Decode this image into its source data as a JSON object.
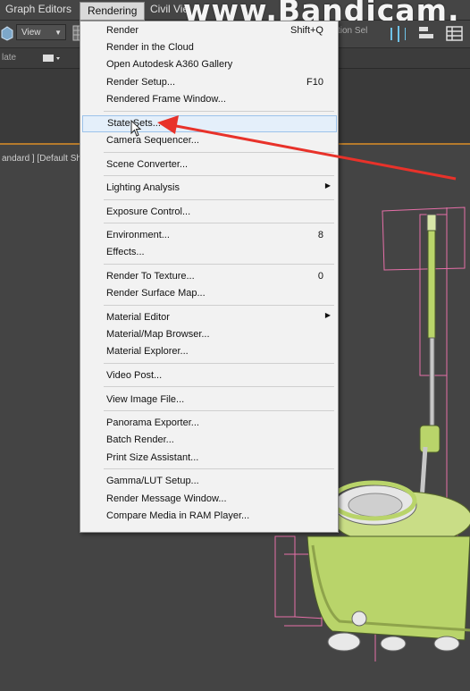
{
  "menubar": {
    "items": [
      {
        "label": "Graph Editors",
        "active": false
      },
      {
        "label": "Rendering",
        "active": true
      },
      {
        "label": "Civil Vie",
        "active": false
      }
    ]
  },
  "watermark": "www.Bandicam.",
  "toolbar": {
    "view_dropdown": "View",
    "selection_set": "tion Sel"
  },
  "row2": {
    "label": "late"
  },
  "viewport": {
    "label": "andard ] [Default Sha"
  },
  "menu": {
    "items": [
      {
        "label": "Render",
        "shortcut": "Shift+Q"
      },
      {
        "label": "Render in the Cloud",
        "shortcut": ""
      },
      {
        "label": "Open Autodesk A360 Gallery",
        "shortcut": ""
      },
      {
        "label": "Render Setup...",
        "shortcut": "F10"
      },
      {
        "label": "Rendered Frame Window...",
        "shortcut": ""
      },
      {
        "label": "State Sets...",
        "shortcut": "",
        "highlighted": true
      },
      {
        "label": "Camera Sequencer...",
        "shortcut": ""
      },
      {
        "label": "Scene Converter...",
        "shortcut": ""
      },
      {
        "label": "Lighting Analysis",
        "shortcut": "",
        "submenu": true
      },
      {
        "label": "Exposure Control...",
        "shortcut": ""
      },
      {
        "label": "Environment...",
        "shortcut": "8"
      },
      {
        "label": "Effects...",
        "shortcut": ""
      },
      {
        "label": "Render To Texture...",
        "shortcut": "0"
      },
      {
        "label": "Render Surface Map...",
        "shortcut": ""
      },
      {
        "label": "Material Editor",
        "shortcut": "",
        "submenu": true
      },
      {
        "label": "Material/Map Browser...",
        "shortcut": ""
      },
      {
        "label": "Material Explorer...",
        "shortcut": ""
      },
      {
        "label": "Video Post...",
        "shortcut": ""
      },
      {
        "label": "View Image File...",
        "shortcut": ""
      },
      {
        "label": "Panorama Exporter...",
        "shortcut": ""
      },
      {
        "label": "Batch Render...",
        "shortcut": ""
      },
      {
        "label": "Print Size Assistant...",
        "shortcut": ""
      },
      {
        "label": "Gamma/LUT Setup...",
        "shortcut": ""
      },
      {
        "label": "Render Message Window...",
        "shortcut": ""
      },
      {
        "label": "Compare Media in RAM Player...",
        "shortcut": ""
      }
    ]
  },
  "colors": {
    "annotation_arrow": "#e8322a",
    "model_green": "#b9d46a",
    "wireframe_pink": "#e66fa8",
    "menu_bg": "#f2f2f2",
    "highlight_bg": "#e4effa"
  },
  "icons": [
    "view-cube-icon",
    "dropdown-arrow-icon",
    "grid-icon",
    "align-icon",
    "submenu-arrow-icon",
    "mouse-cursor-icon"
  ]
}
